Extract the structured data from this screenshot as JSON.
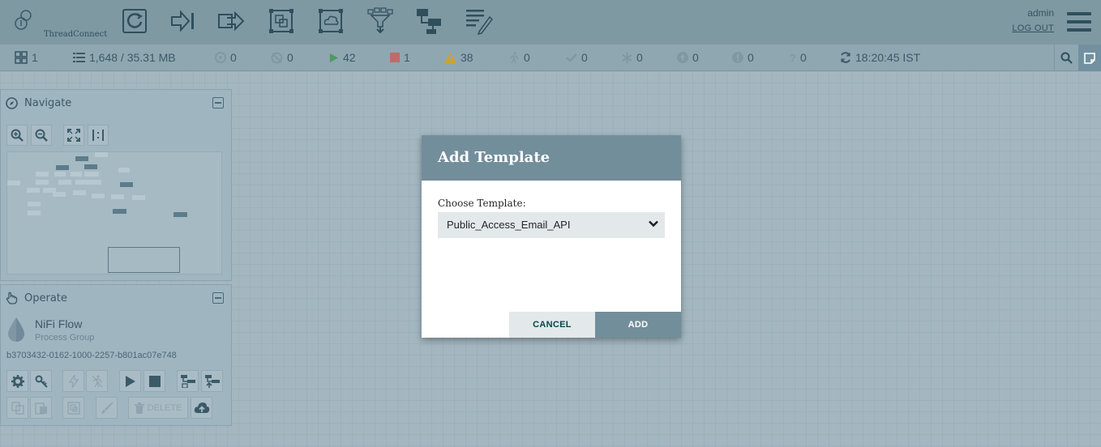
{
  "header": {
    "logo_text": "ThreadConnect",
    "username": "admin",
    "logout_label": "LOG OUT",
    "toolbar_icons": [
      "processor-icon",
      "input-port-icon",
      "output-port-icon",
      "process-group-icon",
      "remote-process-group-icon",
      "funnel-icon",
      "template-icon",
      "label-icon"
    ]
  },
  "status": {
    "active_threads": "1",
    "queued": "1,648 / 35.31 MB",
    "transmitting": "0",
    "not_transmitting": "0",
    "running": "42",
    "stopped": "1",
    "invalid": "38",
    "disabled": "0",
    "up_to_date": "0",
    "locally_modified": "0",
    "stale": "0",
    "locally_modified_stale": "0",
    "sync_failure": "0",
    "refresh_time": "18:20:45 IST"
  },
  "navigate": {
    "title": "Navigate"
  },
  "operate": {
    "title": "Operate",
    "flow_name": "NiFi Flow",
    "flow_type": "Process Group",
    "flow_id": "b3703432-0162-1000-2257-b801ac07e748",
    "delete_label": "DELETE"
  },
  "dialog": {
    "title": "Add Template",
    "choose_label": "Choose Template:",
    "selected_template": "Public_Access_Email_API",
    "cancel_label": "CANCEL",
    "add_label": "ADD"
  },
  "colors": {
    "header_bg": "#7f99a3",
    "dialog_header": "#728e9b",
    "accent_dark": "#004849"
  }
}
